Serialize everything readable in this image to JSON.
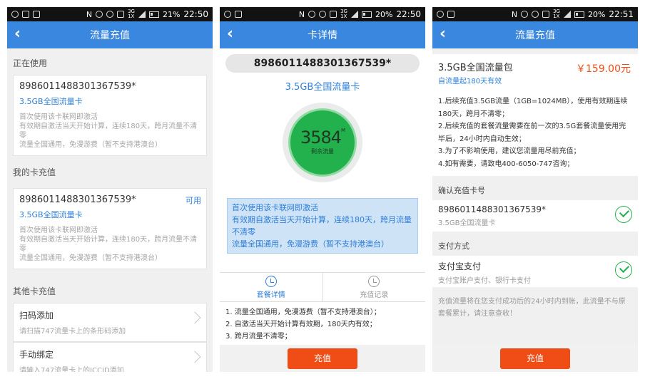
{
  "screens": [
    {
      "status": {
        "battery": "21%",
        "time": "22:50",
        "net_top": "3G",
        "net_bot": "1X"
      },
      "title": "流量充值",
      "in_use": {
        "section": "正在使用",
        "number": "8986011488301367539*",
        "type": "3.5GB全国流量卡",
        "desc": [
          "首次使用该卡联网即激活",
          "有效期自激活当天开始计算，连续180天，跨月流量不清零",
          "流量全国通用，免漫游费（暂不支持港澳台）"
        ]
      },
      "my_card": {
        "section": "我的卡充值",
        "number": "8986011488301367539*",
        "available": "可用",
        "type": "3.5GB全国流量卡",
        "desc": [
          "首次使用该卡联网即激活",
          "有效期自激活当天开始计算，连续180天，跨月流量不清零",
          "流量全国通用，免漫游费（暂不支持港澳台）"
        ]
      },
      "other": {
        "section": "其他卡充值",
        "scan": {
          "title": "扫码添加",
          "sub": "请扫描747流量卡上的条形码添加"
        },
        "manual": {
          "title": "手动绑定",
          "sub": "请输入747流量卡上的ICCID添加"
        }
      }
    },
    {
      "status": {
        "battery": "20%",
        "time": "22:50",
        "net_top": "3G",
        "net_bot": "1X"
      },
      "title": "卡详情",
      "number": "8986011488301367539*",
      "type": "3.5GB全国流量卡",
      "gauge": {
        "value": "3584",
        "unit": "M",
        "label": "剩余流量",
        "fill_fraction": 1.0
      },
      "info": [
        "首次使用该卡联网即激活",
        "有效期自激活当天开始计算，连续180天，跨月流量不清零",
        "流量全国通用，免漫游费（暂不支持港澳台）"
      ],
      "tabs": [
        "套餐详情",
        "充值记录"
      ],
      "rules": [
        "1. 流量全国通用，免漫游费（暂不支持港澳台）；",
        "2. 自激活当天开始计算有效期，180天内有效；",
        "3. 跨月流量不清零；"
      ],
      "button": "充值"
    },
    {
      "status": {
        "battery": "20%",
        "time": "22:51",
        "net_top": "3G",
        "net_bot": "1X"
      },
      "title": "流量充值",
      "package": {
        "name": "3.5GB全国流量包",
        "price": "￥159.00元",
        "valid": "自流量起180天有效",
        "desc": [
          "1.后续充值3.5GB流量（1GB=1024MB），使用有效期连续180天，跨月不清零；",
          "2.后续充值的套餐流量需要在前一次的3.5G套餐流量使用完毕后，24小时内自动生效；",
          "3.为了不影响使用，建议您流量用尽前充值；",
          "4.如有需要，请致电400-6050-747咨询；"
        ]
      },
      "confirm": {
        "section": "确认充值卡号",
        "number": "8986011488301367539*",
        "type": "3.5GB全国流量卡"
      },
      "pay": {
        "section": "支付方式",
        "method": "支付宝支付",
        "sub": "支付宝账户支付、银行卡支付"
      },
      "note": "充值流量将在您支付成功后的24小时内到帐，此流量不与原套餐累计，请注意查收！",
      "button": "充值"
    }
  ]
}
